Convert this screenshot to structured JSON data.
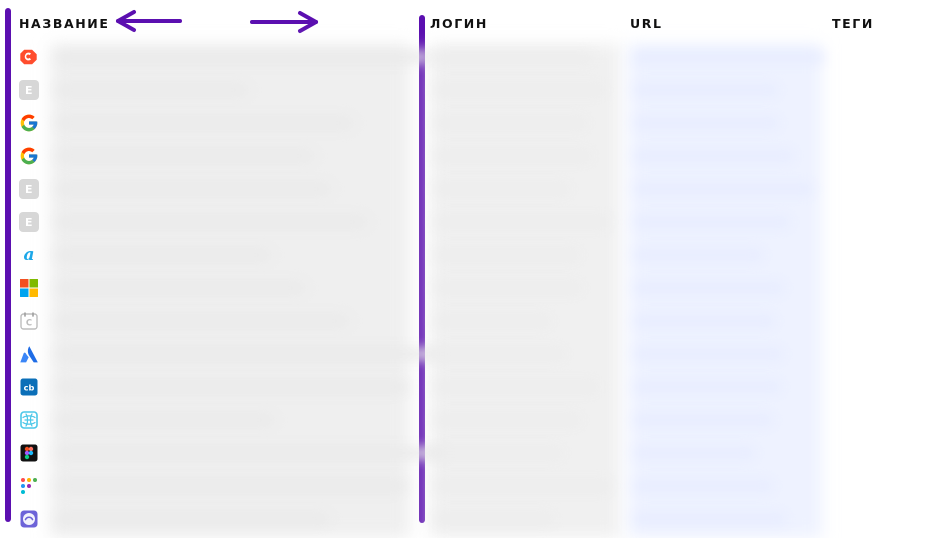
{
  "headers": {
    "name": "НАЗВАНИЕ",
    "login": "ЛОГИН",
    "url": "URL",
    "tags": "ТЕГИ"
  },
  "accent_colors": {
    "divider": "#5b0fb0",
    "arrow": "#5b0fb0",
    "name_blur": "#efefef",
    "login_blur": "#f0f0f0",
    "url_blur": "#eef2ff"
  },
  "rows": [
    {
      "icon": "smartcat-icon"
    },
    {
      "icon": "letter-e-icon",
      "fallback_letter": "E"
    },
    {
      "icon": "google-icon"
    },
    {
      "icon": "google-icon"
    },
    {
      "icon": "letter-e-icon",
      "fallback_letter": "E"
    },
    {
      "icon": "letter-e-icon",
      "fallback_letter": "E"
    },
    {
      "icon": "a-script-icon"
    },
    {
      "icon": "microsoft-icon"
    },
    {
      "icon": "calendar-c-icon"
    },
    {
      "icon": "atlassian-icon"
    },
    {
      "icon": "cb-icon"
    },
    {
      "icon": "network-globe-icon"
    },
    {
      "icon": "figma-icon"
    },
    {
      "icon": "dots-grid-icon"
    },
    {
      "icon": "purple-badge-icon"
    }
  ]
}
